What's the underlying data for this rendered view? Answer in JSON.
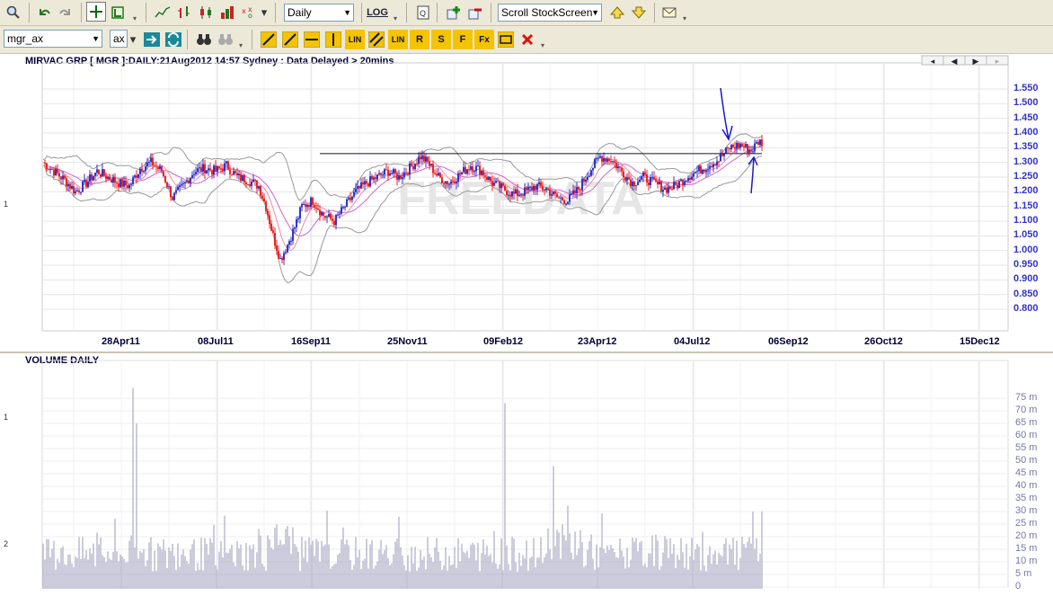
{
  "toolbar1": {
    "icons": [
      "search-icon",
      "undo-icon",
      "redo-icon",
      "crosshair-icon",
      "chart-type-icon",
      "line-chart-icon",
      "ohlc-bar-icon",
      "candlestick-icon",
      "colored-bar-icon",
      "point-figure-icon",
      "dropdown-icon",
      "log-icon",
      "page-icon",
      "add-icon",
      "remove-icon",
      "up-arrow-icon",
      "down-arrow-icon",
      "mail-icon"
    ],
    "period_value": "Daily",
    "log_label": "LOG",
    "screen_value": "Scroll StockScreen"
  },
  "toolbar2": {
    "symbol_value": "mgr_ax",
    "exchange_value": "ax",
    "tool_labels": [
      "LIN",
      "LIN",
      "R",
      "S",
      "F",
      "Fx"
    ]
  },
  "price_panel": {
    "title": "MIRVAC GRP [ MGR ]:DAILY:21Aug2012 14:57 Sydney : Data Delayed > 20mins",
    "side_label": "1",
    "watermark": "FREEDATA",
    "nav_buttons": [
      "first",
      "prev",
      "next",
      "last"
    ]
  },
  "volume_panel": {
    "title": "VOLUME DAILY",
    "side_labels": [
      "1",
      "2"
    ]
  },
  "colors": {
    "bull": "#3333cc",
    "bear": "#ee2222",
    "volume": "#9999bb",
    "axis_text": "#3333cc",
    "annotation": "#1a1acc"
  },
  "chart_data": [
    {
      "type": "candlestick",
      "title": "MIRVAC GRP [ MGR ]:DAILY:21Aug2012 14:57 Sydney : Data Delayed > 20mins",
      "x_ticks": [
        "28Apr11",
        "08Jul11",
        "16Sep11",
        "25Nov11",
        "09Feb12",
        "23Apr12",
        "04Jul12",
        "06Sep12",
        "26Oct12",
        "15Dec12"
      ],
      "y_ticks": [
        "1.550",
        "1.500",
        "1.450",
        "1.400",
        "1.350",
        "1.300",
        "1.250",
        "1.200",
        "1.150",
        "1.100",
        "1.050",
        "1.000",
        "0.950",
        "0.900",
        "0.850",
        "0.800"
      ],
      "ylim": [
        0.8,
        1.55
      ],
      "close_path": [
        [
          0,
          1.3
        ],
        [
          6,
          1.27
        ],
        [
          12,
          1.24
        ],
        [
          18,
          1.2
        ],
        [
          24,
          1.23
        ],
        [
          30,
          1.27
        ],
        [
          36,
          1.25
        ],
        [
          42,
          1.23
        ],
        [
          48,
          1.22
        ],
        [
          54,
          1.28
        ],
        [
          60,
          1.3
        ],
        [
          66,
          1.27
        ],
        [
          72,
          1.18
        ],
        [
          78,
          1.22
        ],
        [
          84,
          1.27
        ],
        [
          90,
          1.28
        ],
        [
          96,
          1.27
        ],
        [
          102,
          1.29
        ],
        [
          108,
          1.25
        ],
        [
          114,
          1.24
        ],
        [
          120,
          1.22
        ],
        [
          124,
          1.15
        ],
        [
          128,
          1.05
        ],
        [
          132,
          0.97
        ],
        [
          136,
          1.02
        ],
        [
          140,
          1.08
        ],
        [
          144,
          1.15
        ],
        [
          150,
          1.17
        ],
        [
          156,
          1.12
        ],
        [
          162,
          1.1
        ],
        [
          168,
          1.15
        ],
        [
          174,
          1.2
        ],
        [
          180,
          1.23
        ],
        [
          186,
          1.25
        ],
        [
          192,
          1.27
        ],
        [
          198,
          1.25
        ],
        [
          204,
          1.28
        ],
        [
          210,
          1.32
        ],
        [
          214,
          1.3
        ],
        [
          220,
          1.25
        ],
        [
          226,
          1.23
        ],
        [
          232,
          1.26
        ],
        [
          238,
          1.29
        ],
        [
          244,
          1.27
        ],
        [
          250,
          1.23
        ],
        [
          256,
          1.21
        ],
        [
          262,
          1.19
        ],
        [
          268,
          1.2
        ],
        [
          274,
          1.22
        ],
        [
          280,
          1.21
        ],
        [
          286,
          1.18
        ],
        [
          292,
          1.17
        ],
        [
          298,
          1.21
        ],
        [
          304,
          1.27
        ],
        [
          310,
          1.32
        ],
        [
          316,
          1.31
        ],
        [
          322,
          1.27
        ],
        [
          328,
          1.23
        ],
        [
          334,
          1.25
        ],
        [
          340,
          1.23
        ],
        [
          346,
          1.21
        ],
        [
          352,
          1.22
        ],
        [
          358,
          1.25
        ],
        [
          364,
          1.27
        ],
        [
          370,
          1.29
        ],
        [
          376,
          1.31
        ],
        [
          382,
          1.35
        ],
        [
          388,
          1.36
        ],
        [
          394,
          1.34
        ],
        [
          398,
          1.37
        ]
      ],
      "resistance_level": 1.33,
      "volume_ylim": [
        0,
        80
      ],
      "volume_y_ticks": [
        "75 m",
        "70 m",
        "65 m",
        "60 m",
        "55 m",
        "50 m",
        "45 m",
        "40 m",
        "35 m",
        "30 m",
        "25 m",
        "20 m",
        "15 m",
        "10 m",
        "5 m",
        "0"
      ],
      "volume_spikes_m": [
        [
          50,
          79
        ],
        [
          52,
          65
        ],
        [
          257,
          73
        ],
        [
          284,
          43
        ],
        [
          400,
          30
        ],
        [
          395,
          30
        ]
      ]
    }
  ]
}
